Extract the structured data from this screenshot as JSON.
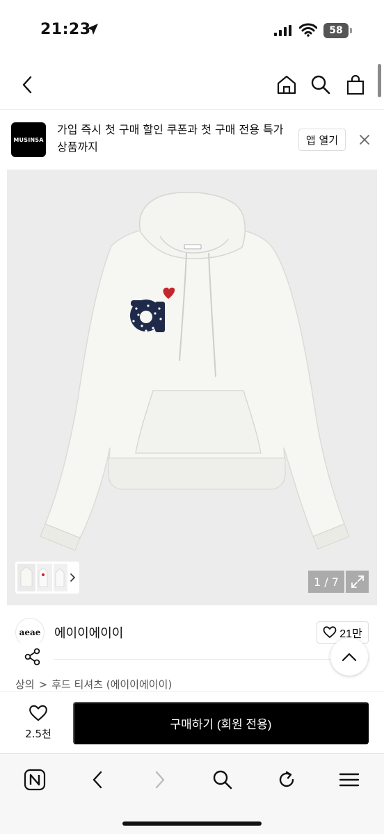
{
  "status_bar": {
    "time": "21:23",
    "battery": "58"
  },
  "header": {
    "icons": [
      "back-chevron-icon",
      "home-icon",
      "search-icon",
      "shopping-bag-icon"
    ]
  },
  "app_banner": {
    "logo_text": "MUSINSA",
    "message": "가입 즉시 첫 구매 할인 쿠폰과 첫 구매 전용 특가 상품까지",
    "open_app_label": "앱 열기"
  },
  "product_image": {
    "counter": "1 / 7",
    "logo_letter": "a"
  },
  "brand": {
    "logo_text": "aeae",
    "name": "에이이에이이",
    "likes": "21만"
  },
  "breadcrumb": {
    "category": "상의",
    "separator": ">",
    "subcategory": "후드 티셔츠 (에이이에이이)"
  },
  "purchase_bar": {
    "wish_count": "2.5천",
    "buy_label": "구매하기 (회원 전용)"
  },
  "colors": {
    "buy_button": "#000000",
    "image_bg": "#ececec",
    "heart_accent": "#c4262e",
    "patch_navy": "#1f2a4a"
  }
}
